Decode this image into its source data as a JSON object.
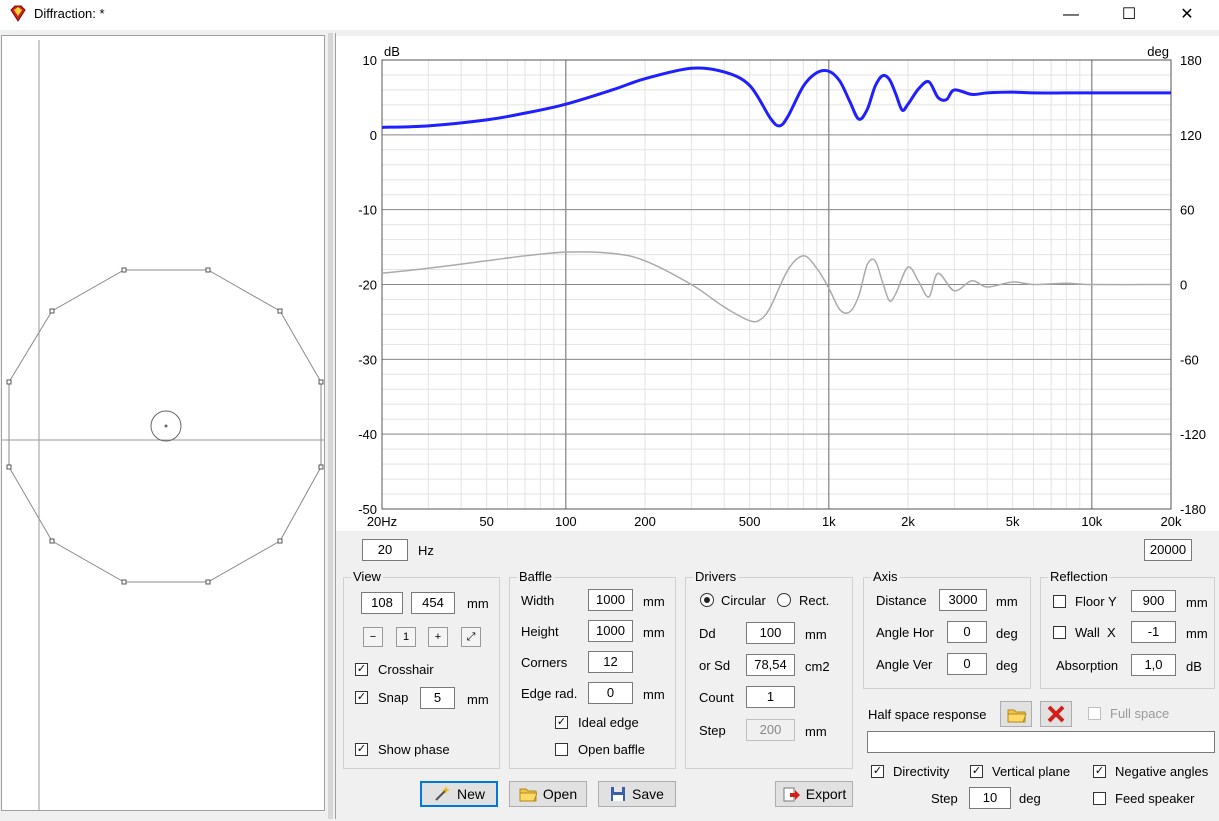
{
  "window": {
    "title": "Diffraction: *",
    "minimize": "—",
    "maximize": "☐",
    "close": "✕"
  },
  "chart_data": {
    "type": "line",
    "xscale": "log",
    "xlim": [
      20,
      20000
    ],
    "ylim": [
      -50,
      10
    ],
    "y2lim": [
      -180,
      180
    ],
    "ylabel": "dB",
    "y2label": "deg",
    "x_ticks": [
      "20Hz",
      "50",
      "100",
      "200",
      "500",
      "1k",
      "2k",
      "5k",
      "10k",
      "20k"
    ],
    "x_tick_values": [
      20,
      50,
      100,
      200,
      500,
      1000,
      2000,
      5000,
      10000,
      20000
    ],
    "y_ticks": [
      "10",
      "0",
      "-10",
      "-20",
      "-30",
      "-40",
      "-50"
    ],
    "y2_ticks": [
      "180",
      "120",
      "60",
      "0",
      "-60",
      "-120",
      "-180"
    ],
    "grid": true,
    "series": [
      {
        "color": "#1f1fff",
        "axis": "left",
        "x": [
          20,
          30,
          50,
          70,
          100,
          150,
          200,
          300,
          400,
          500,
          600,
          650,
          700,
          800,
          900,
          1000,
          1100,
          1200,
          1300,
          1400,
          1500,
          1600,
          1700,
          1800,
          1900,
          2000,
          2200,
          2400,
          2600,
          2800,
          3000,
          3500,
          4000,
          5000,
          6000,
          8000,
          10000,
          20000
        ],
        "y": [
          1,
          1.2,
          2,
          2.9,
          4.1,
          6,
          7.5,
          8.9,
          8.4,
          6.6,
          2.2,
          1.2,
          2.5,
          6.5,
          8.3,
          8.5,
          7.2,
          4.5,
          2.1,
          3.4,
          6.5,
          7.9,
          7.4,
          5.4,
          3.3,
          4.1,
          6.2,
          7.1,
          5.0,
          4.7,
          6.0,
          5.4,
          5.6,
          5.7,
          5.6,
          5.6,
          5.6,
          5.6
        ]
      },
      {
        "color": "#aaaaaa",
        "axis": "right",
        "x": [
          20,
          30,
          50,
          70,
          100,
          150,
          200,
          300,
          400,
          500,
          550,
          600,
          700,
          800,
          900,
          1000,
          1100,
          1200,
          1300,
          1400,
          1500,
          1600,
          1700,
          1800,
          2000,
          2200,
          2400,
          2600,
          3000,
          3500,
          4000,
          5000,
          6000,
          8000,
          10000,
          20000
        ],
        "y": [
          9,
          13,
          19,
          23,
          26,
          25,
          19,
          0,
          -18,
          -29,
          -28,
          -18,
          12,
          23,
          13,
          -3,
          -20,
          -22,
          -9,
          16,
          19,
          2,
          -13,
          -7,
          14,
          2,
          -10,
          9,
          -5,
          3,
          -2,
          2,
          0,
          1,
          0,
          0
        ]
      }
    ]
  },
  "freq": {
    "min": "20",
    "max": "20000",
    "unit": "Hz"
  },
  "view": {
    "title": "View",
    "x": "108",
    "y": "454",
    "unit": "mm",
    "crosshair": "Crosshair",
    "snap": "Snap",
    "snap_value": "5",
    "snap_unit": "mm",
    "show_phase": "Show phase"
  },
  "baffle": {
    "title": "Baffle",
    "width_label": "Width",
    "width": "1000",
    "height_label": "Height",
    "height": "1000",
    "corners_label": "Corners",
    "corners": "12",
    "edge_label": "Edge rad.",
    "edge": "0",
    "unit": "mm",
    "ideal_edge": "Ideal edge",
    "open_baffle": "Open baffle"
  },
  "drivers": {
    "title": "Drivers",
    "circular": "Circular",
    "rect": "Rect.",
    "dd_label": "Dd",
    "dd": "100",
    "dd_unit": "mm",
    "sd_label": "or Sd",
    "sd": "78,54",
    "sd_unit": "cm2",
    "count_label": "Count",
    "count": "1",
    "step_label": "Step",
    "step": "200",
    "step_unit": "mm"
  },
  "axis": {
    "title": "Axis",
    "distance_label": "Distance",
    "distance": "3000",
    "distance_unit": "mm",
    "hor_label": "Angle Hor",
    "hor": "0",
    "ver_label": "Angle Ver",
    "ver": "0",
    "angle_unit": "deg"
  },
  "reflection": {
    "title": "Reflection",
    "floor_label": "Floor Y",
    "floor": "900",
    "wall_label": "Wall  X",
    "wall": "-1",
    "unit": "mm",
    "absorption_label": "Absorption",
    "absorption": "1,0",
    "absorption_unit": "dB"
  },
  "halfspace": {
    "label": "Half space response",
    "full_space": "Full space"
  },
  "directivity": {
    "directivity": "Directivity",
    "vertical": "Vertical plane",
    "negative": "Negative angles",
    "step_label": "Step",
    "step": "10",
    "step_unit": "deg",
    "feed": "Feed speaker"
  },
  "buttons": {
    "new": "New",
    "open": "Open",
    "save": "Save",
    "export": "Export"
  },
  "checks": {
    "mark": "✓"
  }
}
